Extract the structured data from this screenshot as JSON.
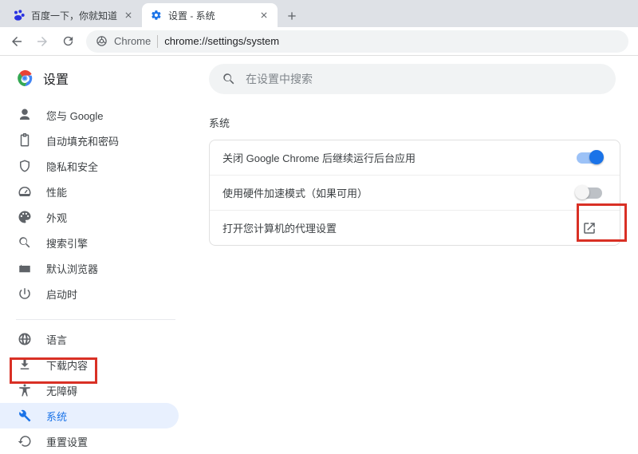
{
  "tabs": [
    {
      "title": "百度一下，你就知道",
      "active": false
    },
    {
      "title": "设置 - 系统",
      "active": true
    }
  ],
  "omnibox": {
    "scheme": "Chrome",
    "url": "chrome://settings/system"
  },
  "app_title": "设置",
  "search_placeholder": "在设置中搜索",
  "sidebar": {
    "items": [
      {
        "label": "您与 Google"
      },
      {
        "label": "自动填充和密码"
      },
      {
        "label": "隐私和安全"
      },
      {
        "label": "性能"
      },
      {
        "label": "外观"
      },
      {
        "label": "搜索引擎"
      },
      {
        "label": "默认浏览器"
      },
      {
        "label": "启动时"
      }
    ],
    "items2": [
      {
        "label": "语言"
      },
      {
        "label": "下载内容"
      },
      {
        "label": "无障碍"
      },
      {
        "label": "系统"
      },
      {
        "label": "重置设置"
      }
    ]
  },
  "section_title": "系统",
  "rows": {
    "bg_apps": "关闭 Google Chrome 后继续运行后台应用",
    "hw_accel": "使用硬件加速模式（如果可用）",
    "proxy": "打开您计算机的代理设置"
  },
  "toggles": {
    "bg_apps_on": true,
    "hw_accel_on": false
  }
}
